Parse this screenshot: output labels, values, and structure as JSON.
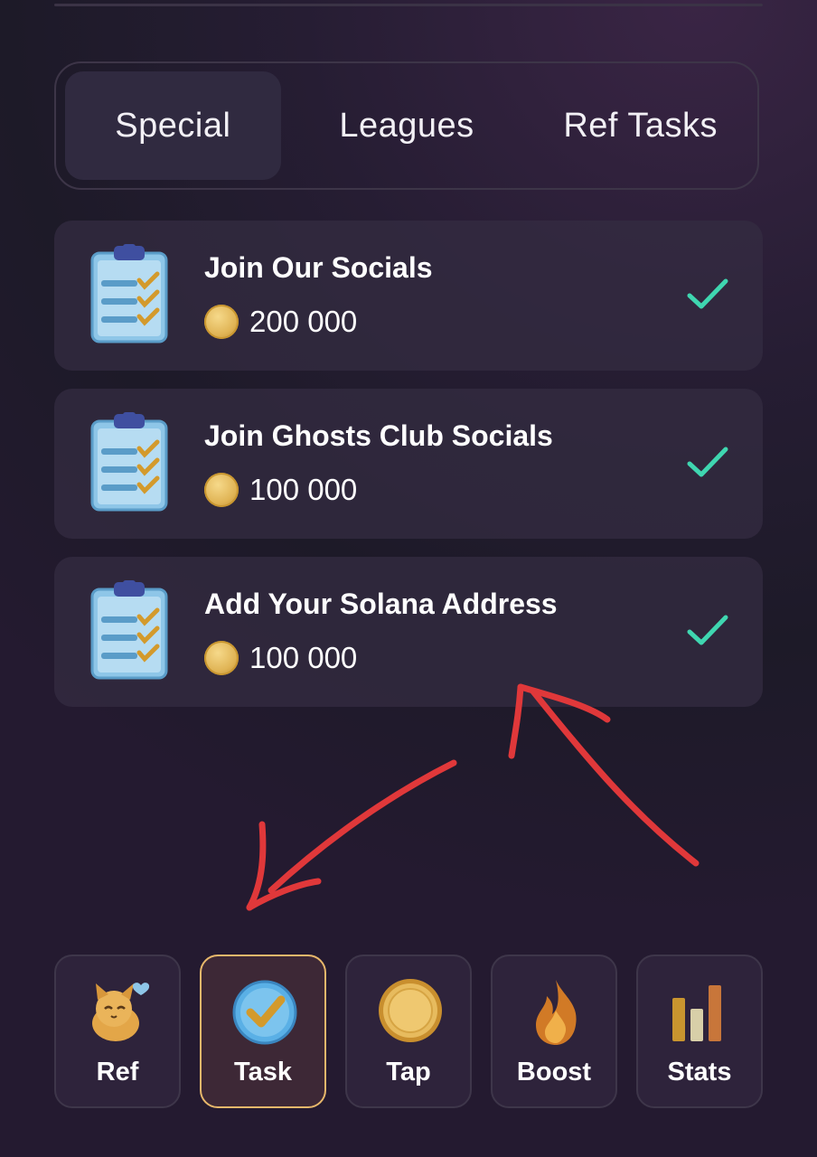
{
  "tabs": [
    {
      "label": "Special",
      "active": true
    },
    {
      "label": "Leagues",
      "active": false
    },
    {
      "label": "Ref Tasks",
      "active": false
    }
  ],
  "tasks": [
    {
      "title": "Join Our Socials",
      "reward": "200 000",
      "completed": true
    },
    {
      "title": "Join Ghosts Club Socials",
      "reward": "100 000",
      "completed": true
    },
    {
      "title": "Add Your Solana Address",
      "reward": "100 000",
      "completed": true
    }
  ],
  "nav": [
    {
      "label": "Ref",
      "icon": "cat-icon",
      "active": false
    },
    {
      "label": "Task",
      "icon": "check-badge-icon",
      "active": true
    },
    {
      "label": "Tap",
      "icon": "coin-icon",
      "active": false
    },
    {
      "label": "Boost",
      "icon": "flame-icon",
      "active": false
    },
    {
      "label": "Stats",
      "icon": "bar-chart-icon",
      "active": false
    }
  ],
  "colors": {
    "accent": "#e8b86b",
    "check": "#3fd6b0",
    "annotation": "#e0383a"
  }
}
